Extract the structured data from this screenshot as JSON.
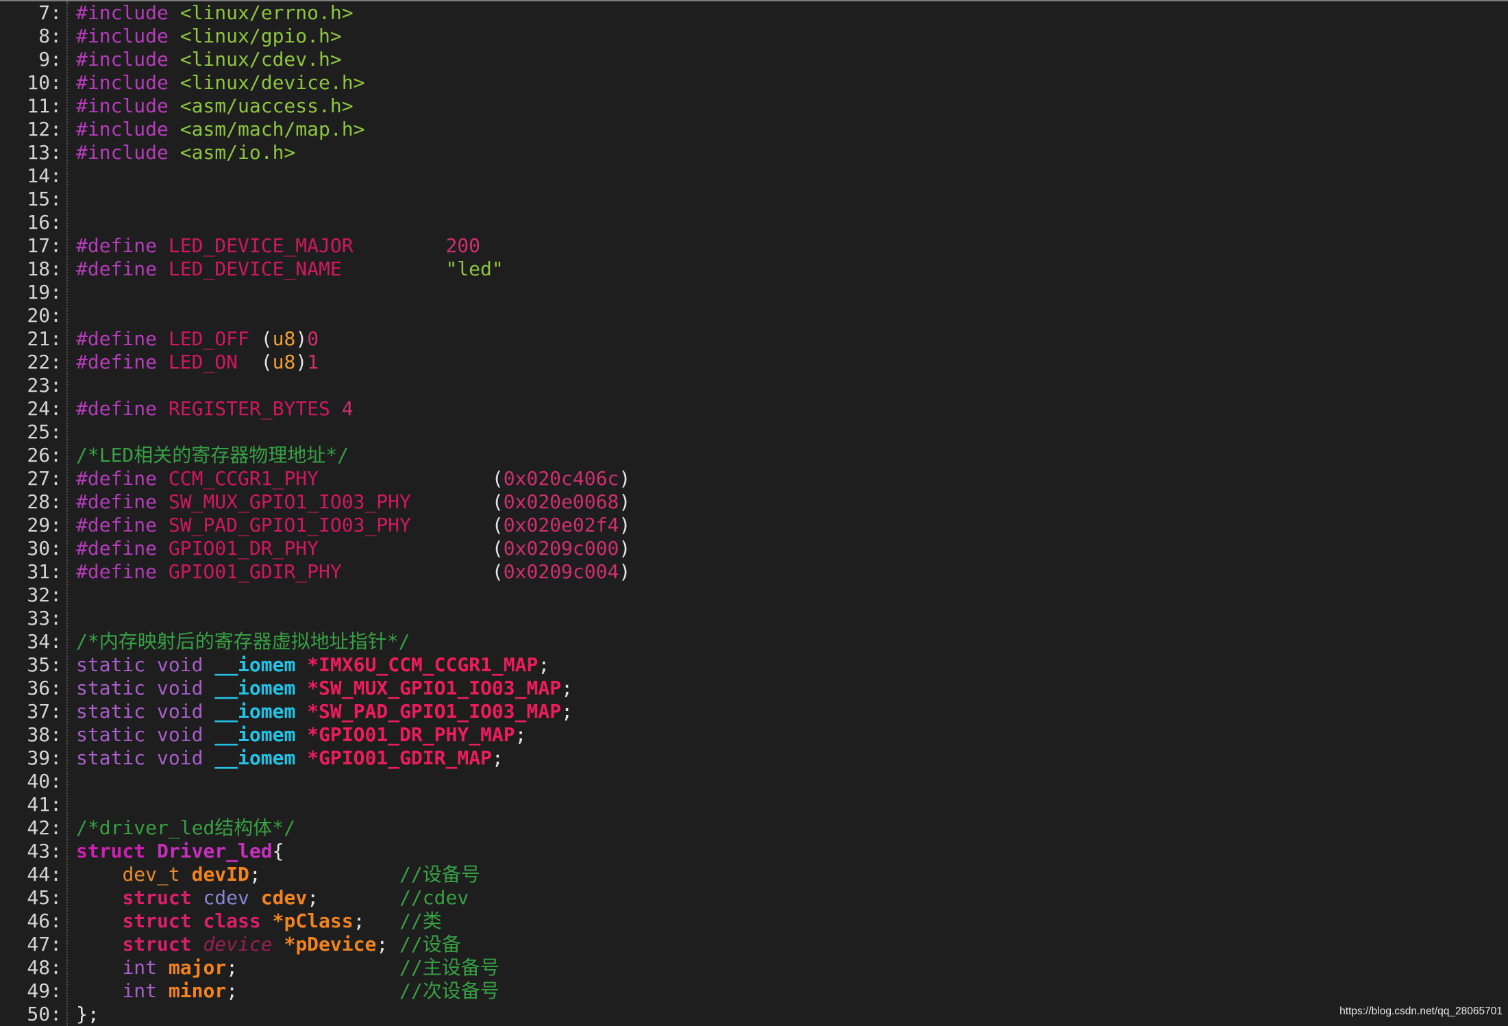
{
  "theme": {
    "background": "#1e1e1e",
    "top-border": "#7c7c7c",
    "separator": "#505050",
    "line-number": "#d4d4d4",
    "preprocessor": "#b63cbc",
    "include-path": "#8dc63f",
    "macro": "#d0195c",
    "number": "#d02f6e",
    "string": "#8dc63f",
    "plain": "#e4e4e4",
    "builtin-type": "#f2a030",
    "comment": "#37a043",
    "keyword": "#a95ecc",
    "qualifier": "#22c3e6",
    "global-var": "#ee1c5e",
    "struct-keyword": "#d120b4",
    "struct-name": "#c82fbe",
    "struct-keyword-member": "#dc1f6b",
    "member": "#f2841f",
    "typedef": "#e9892d",
    "struct-type": "#8e84d6",
    "incomplete-type": "#96204b",
    "watermark": "#e8e8e8"
  },
  "editor": {
    "lines": [
      {
        "number": "7:",
        "tokens": [
          [
            "pp",
            "#include"
          ],
          [
            "p",
            " "
          ],
          [
            "inc",
            "<linux/errno.h>"
          ]
        ]
      },
      {
        "number": "8:",
        "tokens": [
          [
            "pp",
            "#include"
          ],
          [
            "p",
            " "
          ],
          [
            "inc",
            "<linux/gpio.h>"
          ]
        ]
      },
      {
        "number": "9:",
        "tokens": [
          [
            "pp",
            "#include"
          ],
          [
            "p",
            " "
          ],
          [
            "inc",
            "<linux/cdev.h>"
          ]
        ]
      },
      {
        "number": "10:",
        "tokens": [
          [
            "pp",
            "#include"
          ],
          [
            "p",
            " "
          ],
          [
            "inc",
            "<linux/device.h>"
          ]
        ]
      },
      {
        "number": "11:",
        "tokens": [
          [
            "pp",
            "#include"
          ],
          [
            "p",
            " "
          ],
          [
            "inc",
            "<asm/uaccess.h>"
          ]
        ]
      },
      {
        "number": "12:",
        "tokens": [
          [
            "pp",
            "#include"
          ],
          [
            "p",
            " "
          ],
          [
            "inc",
            "<asm/mach/map.h>"
          ]
        ]
      },
      {
        "number": "13:",
        "tokens": [
          [
            "pp",
            "#include"
          ],
          [
            "p",
            " "
          ],
          [
            "inc",
            "<asm/io.h>"
          ]
        ]
      },
      {
        "number": "14:",
        "tokens": []
      },
      {
        "number": "15:",
        "tokens": []
      },
      {
        "number": "16:",
        "tokens": []
      },
      {
        "number": "17:",
        "tokens": [
          [
            "pp",
            "#define"
          ],
          [
            "p",
            " "
          ],
          [
            "macro",
            "LED_DEVICE_MAJOR"
          ],
          [
            "p",
            "        "
          ],
          [
            "num",
            "200"
          ]
        ]
      },
      {
        "number": "18:",
        "tokens": [
          [
            "pp",
            "#define"
          ],
          [
            "p",
            " "
          ],
          [
            "macro",
            "LED_DEVICE_NAME"
          ],
          [
            "p",
            "         "
          ],
          [
            "str",
            "\"led\""
          ]
        ]
      },
      {
        "number": "19:",
        "tokens": []
      },
      {
        "number": "20:",
        "tokens": []
      },
      {
        "number": "21:",
        "tokens": [
          [
            "pp",
            "#define"
          ],
          [
            "p",
            " "
          ],
          [
            "macro",
            "LED_OFF"
          ],
          [
            "p",
            " ("
          ],
          [
            "type",
            "u8"
          ],
          [
            "p",
            ")"
          ],
          [
            "num",
            "0"
          ]
        ]
      },
      {
        "number": "22:",
        "tokens": [
          [
            "pp",
            "#define"
          ],
          [
            "p",
            " "
          ],
          [
            "macro",
            "LED_ON"
          ],
          [
            "p",
            "  ("
          ],
          [
            "type",
            "u8"
          ],
          [
            "p",
            ")"
          ],
          [
            "num",
            "1"
          ]
        ]
      },
      {
        "number": "23:",
        "tokens": []
      },
      {
        "number": "24:",
        "tokens": [
          [
            "pp",
            "#define"
          ],
          [
            "p",
            " "
          ],
          [
            "macro",
            "REGISTER_BYTES"
          ],
          [
            "p",
            " "
          ],
          [
            "num",
            "4"
          ]
        ]
      },
      {
        "number": "25:",
        "tokens": []
      },
      {
        "number": "26:",
        "tokens": [
          [
            "cmt",
            "/*LED相关的寄存器物理地址*/"
          ]
        ]
      },
      {
        "number": "27:",
        "tokens": [
          [
            "pp",
            "#define"
          ],
          [
            "p",
            " "
          ],
          [
            "macro",
            "CCM_CCGR1_PHY"
          ],
          [
            "p",
            "               ("
          ],
          [
            "num",
            "0x020c406c"
          ],
          [
            "p",
            ")"
          ]
        ]
      },
      {
        "number": "28:",
        "tokens": [
          [
            "pp",
            "#define"
          ],
          [
            "p",
            " "
          ],
          [
            "macro",
            "SW_MUX_GPIO1_IO03_PHY"
          ],
          [
            "p",
            "       ("
          ],
          [
            "num",
            "0x020e0068"
          ],
          [
            "p",
            ")"
          ]
        ]
      },
      {
        "number": "29:",
        "tokens": [
          [
            "pp",
            "#define"
          ],
          [
            "p",
            " "
          ],
          [
            "macro",
            "SW_PAD_GPIO1_IO03_PHY"
          ],
          [
            "p",
            "       ("
          ],
          [
            "num",
            "0x020e02f4"
          ],
          [
            "p",
            ")"
          ]
        ]
      },
      {
        "number": "30:",
        "tokens": [
          [
            "pp",
            "#define"
          ],
          [
            "p",
            " "
          ],
          [
            "macro",
            "GPIO01_DR_PHY"
          ],
          [
            "p",
            "               ("
          ],
          [
            "num",
            "0x0209c000"
          ],
          [
            "p",
            ")"
          ]
        ]
      },
      {
        "number": "31:",
        "tokens": [
          [
            "pp",
            "#define"
          ],
          [
            "p",
            " "
          ],
          [
            "macro",
            "GPIO01_GDIR_PHY"
          ],
          [
            "p",
            "             ("
          ],
          [
            "num",
            "0x0209c004"
          ],
          [
            "p",
            ")"
          ]
        ]
      },
      {
        "number": "32:",
        "tokens": []
      },
      {
        "number": "33:",
        "tokens": []
      },
      {
        "number": "34:",
        "tokens": [
          [
            "cmt",
            "/*内存映射后的寄存器虚拟地址指针*/"
          ]
        ]
      },
      {
        "number": "35:",
        "tokens": [
          [
            "kw",
            "static"
          ],
          [
            "p",
            " "
          ],
          [
            "kw",
            "void"
          ],
          [
            "p",
            " "
          ],
          [
            "attr",
            "__iomem"
          ],
          [
            "p",
            " "
          ],
          [
            "gvar",
            "*IMX6U_CCM_CCGR1_MAP"
          ],
          [
            "p",
            ";"
          ]
        ]
      },
      {
        "number": "36:",
        "tokens": [
          [
            "kw",
            "static"
          ],
          [
            "p",
            " "
          ],
          [
            "kw",
            "void"
          ],
          [
            "p",
            " "
          ],
          [
            "attr",
            "__iomem"
          ],
          [
            "p",
            " "
          ],
          [
            "gvar",
            "*SW_MUX_GPIO1_IO03_MAP"
          ],
          [
            "p",
            ";"
          ]
        ]
      },
      {
        "number": "37:",
        "tokens": [
          [
            "kw",
            "static"
          ],
          [
            "p",
            " "
          ],
          [
            "kw",
            "void"
          ],
          [
            "p",
            " "
          ],
          [
            "attr",
            "__iomem"
          ],
          [
            "p",
            " "
          ],
          [
            "gvar",
            "*SW_PAD_GPIO1_IO03_MAP"
          ],
          [
            "p",
            ";"
          ]
        ]
      },
      {
        "number": "38:",
        "tokens": [
          [
            "kw",
            "static"
          ],
          [
            "p",
            " "
          ],
          [
            "kw",
            "void"
          ],
          [
            "p",
            " "
          ],
          [
            "attr",
            "__iomem"
          ],
          [
            "p",
            " "
          ],
          [
            "gvar",
            "*GPIO01_DR_PHY_MAP"
          ],
          [
            "p",
            ";"
          ]
        ]
      },
      {
        "number": "39:",
        "tokens": [
          [
            "kw",
            "static"
          ],
          [
            "p",
            " "
          ],
          [
            "kw",
            "void"
          ],
          [
            "p",
            " "
          ],
          [
            "attr",
            "__iomem"
          ],
          [
            "p",
            " "
          ],
          [
            "gvar",
            "*GPIO01_GDIR_MAP"
          ],
          [
            "p",
            ";"
          ]
        ]
      },
      {
        "number": "40:",
        "tokens": []
      },
      {
        "number": "41:",
        "tokens": []
      },
      {
        "number": "42:",
        "tokens": [
          [
            "cmt",
            "/*driver_led结构体*/"
          ]
        ]
      },
      {
        "number": "43:",
        "tokens": [
          [
            "skw",
            "struct"
          ],
          [
            "p",
            " "
          ],
          [
            "sname",
            "Driver_led"
          ],
          [
            "p",
            "{"
          ]
        ]
      },
      {
        "number": "44:",
        "tokens": [
          [
            "p",
            "    "
          ],
          [
            "utype",
            "dev_t"
          ],
          [
            "p",
            " "
          ],
          [
            "mem",
            "devID"
          ],
          [
            "p",
            ";"
          ],
          [
            "p",
            "            "
          ],
          [
            "cmt",
            "//设备号"
          ]
        ]
      },
      {
        "number": "45:",
        "tokens": [
          [
            "p",
            "    "
          ],
          [
            "skw2",
            "struct"
          ],
          [
            "p",
            " "
          ],
          [
            "ctype",
            "cdev"
          ],
          [
            "p",
            " "
          ],
          [
            "mem",
            "cdev"
          ],
          [
            "p",
            ";"
          ],
          [
            "p",
            "       "
          ],
          [
            "cmt",
            "//cdev"
          ]
        ]
      },
      {
        "number": "46:",
        "tokens": [
          [
            "p",
            "    "
          ],
          [
            "skw2",
            "struct"
          ],
          [
            "p",
            " "
          ],
          [
            "skw2",
            "class"
          ],
          [
            "p",
            " "
          ],
          [
            "mem",
            "*pClass"
          ],
          [
            "p",
            ";"
          ],
          [
            "p",
            "   "
          ],
          [
            "cmt",
            "//类"
          ]
        ]
      },
      {
        "number": "47:",
        "tokens": [
          [
            "p",
            "    "
          ],
          [
            "skw2",
            "struct"
          ],
          [
            "p",
            " "
          ],
          [
            "itype",
            "device"
          ],
          [
            "p",
            " "
          ],
          [
            "mem",
            "*pDevice"
          ],
          [
            "p",
            ";"
          ],
          [
            "p",
            " "
          ],
          [
            "cmt",
            "//设备"
          ]
        ]
      },
      {
        "number": "48:",
        "tokens": [
          [
            "p",
            "    "
          ],
          [
            "kw",
            "int"
          ],
          [
            "p",
            " "
          ],
          [
            "mem",
            "major"
          ],
          [
            "p",
            ";"
          ],
          [
            "p",
            "              "
          ],
          [
            "cmt",
            "//主设备号"
          ]
        ]
      },
      {
        "number": "49:",
        "tokens": [
          [
            "p",
            "    "
          ],
          [
            "kw",
            "int"
          ],
          [
            "p",
            " "
          ],
          [
            "mem",
            "minor"
          ],
          [
            "p",
            ";"
          ],
          [
            "p",
            "              "
          ],
          [
            "cmt",
            "//次设备号"
          ]
        ]
      },
      {
        "number": "50:",
        "tokens": [
          [
            "p",
            "};"
          ]
        ]
      }
    ]
  },
  "watermark": {
    "text": "https://blog.csdn.net/qq_28065701"
  }
}
